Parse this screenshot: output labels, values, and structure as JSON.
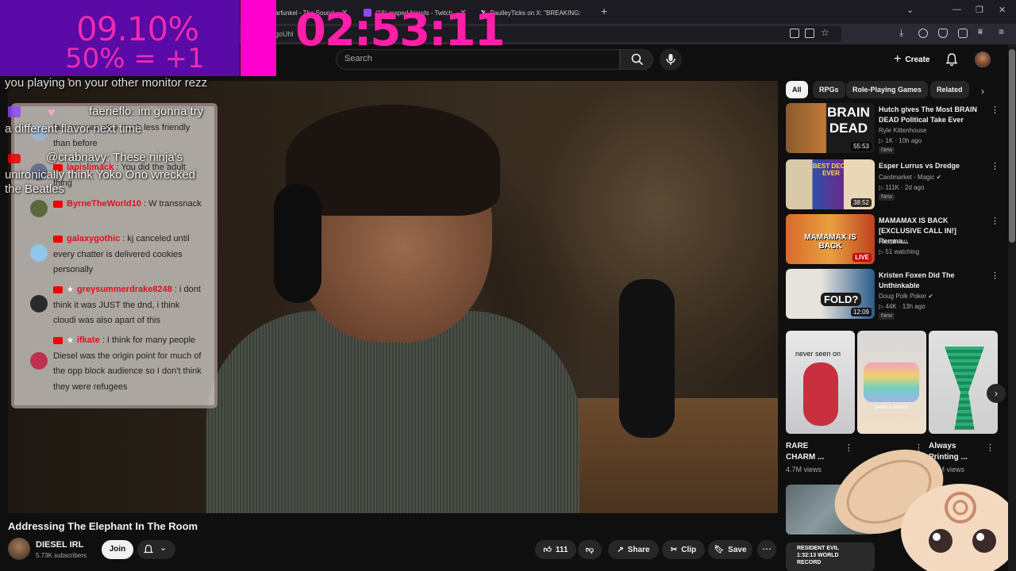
{
  "browser": {
    "tabs": [
      {
        "label": "Garfunkel - The Sound"
      },
      {
        "label": "(18) graped friends - Twitch"
      },
      {
        "label": "PaulleyTicks on X: \"BREAKING:"
      }
    ],
    "url_fragment": "goUhl"
  },
  "overlay": {
    "percent": "09.10%",
    "rule": "50% = +1 hr",
    "timer": "02:53:11"
  },
  "header": {
    "search_placeholder": "Search",
    "create_label": "Create"
  },
  "chat": {
    "floating": [
      "you playing on your other monitor rezz",
      "faerieflo: im gonna try",
      "a different flavor next time",
      "@crabnavy: These ninja's",
      "unironically think Yoko Ono wrecked",
      "the Beatles"
    ],
    "messages": [
      {
        "user": "",
        "text": "last arc was also much less friendly than before"
      },
      {
        "user": "lapislimack",
        "text": "You did the adult thing"
      },
      {
        "user": "ByrneTheWorld10",
        "text": "W transsnack"
      },
      {
        "user": "galaxygothic",
        "text": "kj canceled until every chatter is delivered cookies personally"
      },
      {
        "user": "greysummerdrake8248",
        "text": "i dont think it was JUST the dnd, i think cloudi was also apart of this"
      },
      {
        "user": "ifkate",
        "text": "I think for many people Diesel was the origin point for much of the opp block audience so I don't think they were refugees"
      }
    ]
  },
  "video": {
    "title": "Addressing The Elephant In The Room",
    "channel": "DIESEL IRL",
    "subscribers": "5.73K subscribers",
    "join_label": "Join",
    "likes": "111",
    "share_label": "Share",
    "clip_label": "Clip",
    "save_label": "Save"
  },
  "sidebar": {
    "chips": [
      "All",
      "RPGs",
      "Role-Playing Games",
      "Related"
    ],
    "recommendations": [
      {
        "title": "Hutch gives The Most BRAIN DEAD Political Take Ever",
        "channel": "Ryle Kittenhouse",
        "meta": "1K · 10h ago",
        "badge": "New",
        "duration": "55:53",
        "thumb_text": "BRAIN DEAD"
      },
      {
        "title": "Esper Lurrus vs Dredge",
        "channel": "Cardmarket - Magic",
        "meta": "111K · 2d ago",
        "badge": "New",
        "duration": "38:52",
        "thumb_text": "BEST DECK EVER"
      },
      {
        "title": "MAMAMAX IS BACK [EXCLUSIVE CALL IN!] Remna...",
        "channel": "Himpleton",
        "meta": "51 watching",
        "badge": "",
        "duration": "LIVE",
        "thumb_text": "MAMAMAX IS BACK"
      },
      {
        "title": "Kristen Foxen Did The Unthinkable",
        "channel": "Doug Polk Poker",
        "meta": "44K · 13h ago",
        "badge": "New",
        "duration": "12:09",
        "thumb_text": "FOLD?"
      }
    ],
    "shorts": [
      {
        "title": "RARE CHARM ...",
        "views": "4.7M views",
        "overlay": "never seen on"
      },
      {
        "title": "",
        "views": "",
        "overlay": "packs a serious"
      },
      {
        "title": "Always Printing ...",
        "views": "6.9M views",
        "overlay": ""
      }
    ],
    "lower": [
      {
        "title": "",
        "overlay": ""
      },
      {
        "title": "",
        "overlay": "RESIDENT EVIL 1:32:13 WORLD RECORD"
      }
    ]
  },
  "colors": {
    "overlay_purple": "#5a0aa6",
    "overlay_pink": "#ff00cc",
    "timer_pink": "#ff1fa8",
    "chat_username": "#e01020",
    "yt_bg": "#0f0f0f"
  }
}
